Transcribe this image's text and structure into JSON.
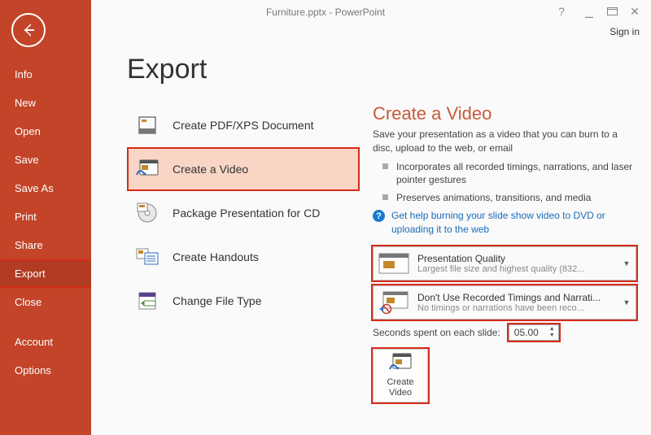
{
  "titlebar": {
    "text": "Furniture.pptx - PowerPoint"
  },
  "signin": "Sign in",
  "sidebar": {
    "items": [
      "Info",
      "New",
      "Open",
      "Save",
      "Save As",
      "Print",
      "Share",
      "Export",
      "Close"
    ],
    "bottom": [
      "Account",
      "Options"
    ]
  },
  "page": {
    "title": "Export"
  },
  "exportOptions": [
    {
      "label": "Create PDF/XPS Document"
    },
    {
      "label": "Create a Video"
    },
    {
      "label": "Package Presentation for CD"
    },
    {
      "label": "Create Handouts"
    },
    {
      "label": "Change File Type"
    }
  ],
  "details": {
    "heading": "Create a Video",
    "desc": "Save your presentation as a video that you can burn to a disc, upload to the web, or email",
    "bullets": [
      "Incorporates all recorded timings, narrations, and laser pointer gestures",
      "Preserves animations, transitions, and media"
    ],
    "helpLink": "Get help burning your slide show video to DVD or uploading it to the web"
  },
  "quality": {
    "title": "Presentation Quality",
    "sub": "Largest file size and highest quality (832..."
  },
  "timings": {
    "title": "Don't Use Recorded Timings and Narrati...",
    "sub": "No timings or narrations have been reco..."
  },
  "seconds": {
    "label": "Seconds spent on each slide:",
    "value": "05.00"
  },
  "createBtn": {
    "line1": "Create",
    "line2": "Video"
  }
}
